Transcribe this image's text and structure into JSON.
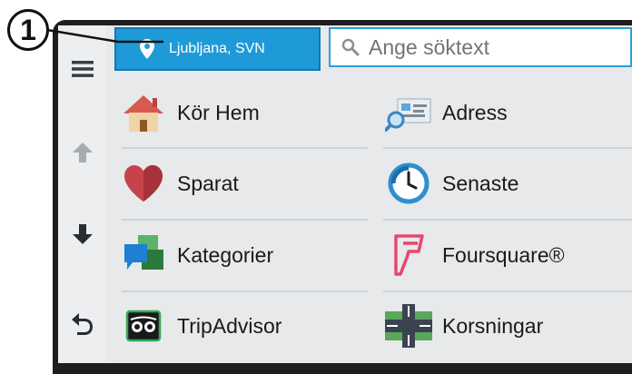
{
  "callout": {
    "number": "1"
  },
  "location_button": {
    "label": "Ljubljana, SVN",
    "icon": "map-pin-icon"
  },
  "search": {
    "placeholder": "Ange söktext",
    "icon": "search-icon"
  },
  "sidebar": {
    "menu_icon": "hamburger-menu-icon",
    "up_icon": "arrow-up-icon",
    "down_icon": "arrow-down-icon",
    "back_icon": "back-arrow-icon"
  },
  "categories": [
    {
      "label": "Kör Hem",
      "icon": "home-icon"
    },
    {
      "label": "Adress",
      "icon": "address-icon"
    },
    {
      "label": "Sparat",
      "icon": "heart-icon"
    },
    {
      "label": "Senaste",
      "icon": "recent-clock-icon"
    },
    {
      "label": "Kategorier",
      "icon": "categories-icon"
    },
    {
      "label": "Foursquare®",
      "icon": "foursquare-icon"
    },
    {
      "label": "TripAdvisor",
      "icon": "tripadvisor-icon"
    },
    {
      "label": "Korsningar",
      "icon": "intersection-icon"
    }
  ],
  "colors": {
    "accent": "#1f9ad8",
    "bezel": "#1e1e1e",
    "screen_bg": "#e7e9eb"
  }
}
